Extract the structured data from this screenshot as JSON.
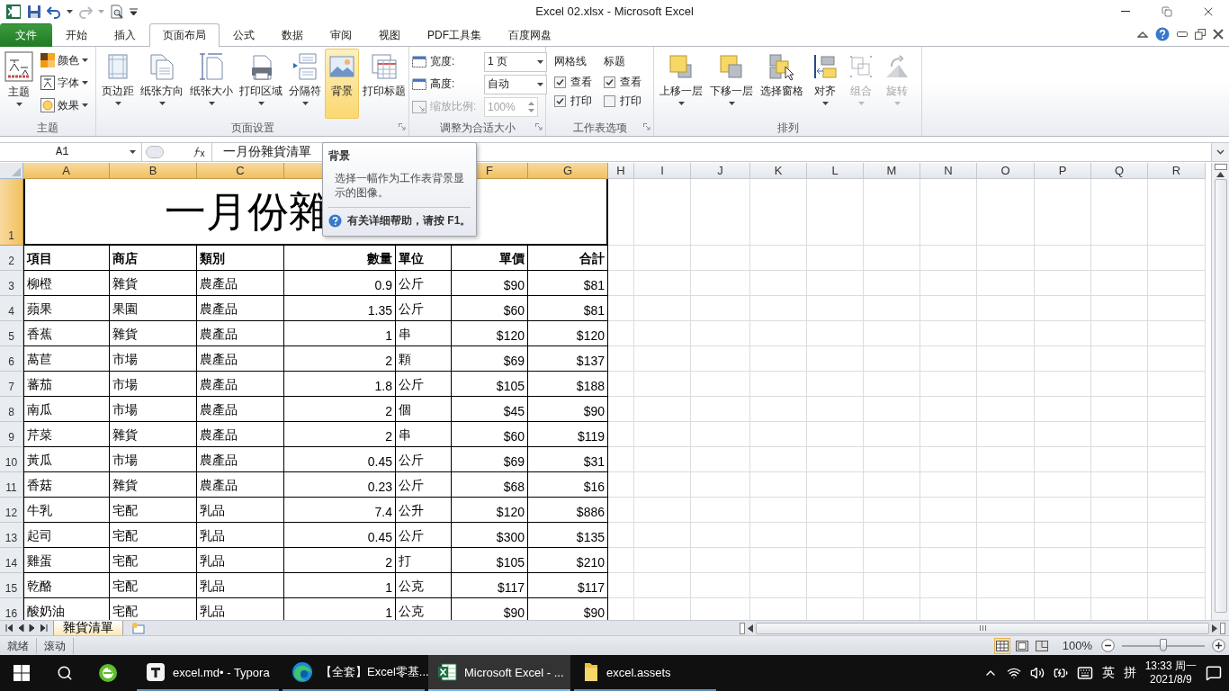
{
  "window": {
    "title": "Excel 02.xlsx  -  Microsoft Excel"
  },
  "ribbon_tabs": [
    {
      "label": "文件",
      "kind": "file",
      "selected": false
    },
    {
      "label": "开始",
      "kind": "tab",
      "selected": false
    },
    {
      "label": "插入",
      "kind": "tab",
      "selected": false
    },
    {
      "label": "页面布局",
      "kind": "tab",
      "selected": true
    },
    {
      "label": "公式",
      "kind": "tab",
      "selected": false
    },
    {
      "label": "数据",
      "kind": "tab",
      "selected": false
    },
    {
      "label": "审阅",
      "kind": "tab",
      "selected": false
    },
    {
      "label": "视图",
      "kind": "tab",
      "selected": false
    },
    {
      "label": "PDF工具集",
      "kind": "tab",
      "selected": false
    },
    {
      "label": "百度网盘",
      "kind": "tab",
      "selected": false
    }
  ],
  "theme_group": {
    "label": "主题",
    "button": "主题",
    "items": [
      {
        "label": "颜色",
        "kind": "colors"
      },
      {
        "label": "字体",
        "kind": "fonts"
      },
      {
        "label": "效果",
        "kind": "effects"
      }
    ]
  },
  "page_setup_group": {
    "label": "页面设置",
    "buttons": [
      {
        "label": "页边距",
        "kind": "margins",
        "dropdown": true,
        "selected": false
      },
      {
        "label": "纸张方向",
        "kind": "orientation",
        "dropdown": true,
        "selected": false
      },
      {
        "label": "纸张大小",
        "kind": "size",
        "dropdown": true,
        "selected": false
      },
      {
        "label": "打印区域",
        "kind": "print-area",
        "dropdown": true,
        "selected": false
      },
      {
        "label": "分隔符",
        "kind": "breaks",
        "dropdown": true,
        "selected": false
      },
      {
        "label": "背景",
        "kind": "background",
        "dropdown": false,
        "selected": true
      },
      {
        "label": "打印标题",
        "kind": "print-titles",
        "dropdown": false,
        "selected": false
      }
    ]
  },
  "scale_group": {
    "label": "调整为合适大小",
    "width": {
      "label": "宽度:",
      "value": "1 页"
    },
    "height": {
      "label": "高度:",
      "value": "自动"
    },
    "scale": {
      "label": "缩放比例:",
      "value": "100%",
      "disabled": true
    }
  },
  "sheet_options_group": {
    "label": "工作表选项",
    "columns": [
      {
        "title": "网格线",
        "view": {
          "label": "查看",
          "checked": true
        },
        "print": {
          "label": "打印",
          "checked": true
        }
      },
      {
        "title": "标题",
        "view": {
          "label": "查看",
          "checked": true
        },
        "print": {
          "label": "打印",
          "checked": false
        }
      }
    ]
  },
  "arrange_group": {
    "label": "排列",
    "buttons": [
      {
        "label": "上移一层",
        "kind": "bring-forward",
        "dropdown": true,
        "disabled": false
      },
      {
        "label": "下移一层",
        "kind": "send-backward",
        "dropdown": true,
        "disabled": false
      },
      {
        "label": "选择窗格",
        "kind": "selection-pane",
        "dropdown": false,
        "disabled": false
      },
      {
        "label": "对齐",
        "kind": "align",
        "dropdown": true,
        "disabled": false
      },
      {
        "label": "组合",
        "kind": "group",
        "dropdown": true,
        "disabled": true
      },
      {
        "label": "旋转",
        "kind": "rotate",
        "dropdown": true,
        "disabled": true
      }
    ]
  },
  "formula_bar": {
    "name_box": "A1",
    "formula": "一月份雜貨清單"
  },
  "tooltip": {
    "title": "背景",
    "body": "选择一幅作为工作表背景显示的图像。",
    "help": "有关详细帮助，请按 F1。"
  },
  "sheet": {
    "columns": [
      {
        "label": "A",
        "selected": true
      },
      {
        "label": "B",
        "selected": true
      },
      {
        "label": "C",
        "selected": true
      },
      {
        "selected": true
      },
      {},
      {
        "label": "F",
        "selected": true
      },
      {
        "label": "G",
        "selected": true
      },
      {
        "label": "H",
        "selected": false
      },
      {
        "label": "I",
        "selected": false
      },
      {
        "label": "J",
        "selected": false
      },
      {
        "label": "K",
        "selected": false
      },
      {
        "label": "L",
        "selected": false
      },
      {
        "label": "M",
        "selected": false
      },
      {
        "label": "N",
        "selected": false
      },
      {
        "label": "O",
        "selected": false
      },
      {
        "label": "P",
        "selected": false
      },
      {
        "label": "Q",
        "selected": false
      },
      {
        "label": "R",
        "selected": false
      }
    ],
    "rows": [
      {
        "number": "1",
        "selected": true,
        "kind": "title",
        "cells": [
          "",
          "",
          "一月份雜"
        ]
      },
      {
        "number": "2",
        "selected": false,
        "kind": "header",
        "cells": [
          "項目",
          "商店",
          "類別",
          "數量",
          "單位",
          "單價",
          "合計"
        ]
      },
      {
        "number": "3",
        "selected": false,
        "kind": "data",
        "cells": [
          "柳橙",
          "雜貨",
          "農產品",
          "0.9",
          "公斤",
          "$90",
          "$81"
        ]
      },
      {
        "number": "4",
        "selected": false,
        "kind": "data",
        "cells": [
          "蘋果",
          "果園",
          "農產品",
          "1.35",
          "公斤",
          "$60",
          "$81"
        ]
      },
      {
        "number": "5",
        "selected": false,
        "kind": "data",
        "cells": [
          "香蕉",
          "雜貨",
          "農產品",
          "1",
          "串",
          "$120",
          "$120"
        ]
      },
      {
        "number": "6",
        "selected": false,
        "kind": "data",
        "cells": [
          "萵苣",
          "市場",
          "農產品",
          "2",
          "顆",
          "$69",
          "$137"
        ]
      },
      {
        "number": "7",
        "selected": false,
        "kind": "data",
        "cells": [
          "蕃茄",
          "市場",
          "農產品",
          "1.8",
          "公斤",
          "$105",
          "$188"
        ]
      },
      {
        "number": "8",
        "selected": false,
        "kind": "data",
        "cells": [
          "南瓜",
          "市場",
          "農產品",
          "2",
          "個",
          "$45",
          "$90"
        ]
      },
      {
        "number": "9",
        "selected": false,
        "kind": "data",
        "cells": [
          "芹菜",
          "雜貨",
          "農產品",
          "2",
          "串",
          "$60",
          "$119"
        ]
      },
      {
        "number": "10",
        "selected": false,
        "kind": "data",
        "cells": [
          "黃瓜",
          "市場",
          "農產品",
          "0.45",
          "公斤",
          "$69",
          "$31"
        ]
      },
      {
        "number": "11",
        "selected": false,
        "kind": "data",
        "cells": [
          "香菇",
          "雜貨",
          "農產品",
          "0.23",
          "公斤",
          "$68",
          "$16"
        ]
      },
      {
        "number": "12",
        "selected": false,
        "kind": "data",
        "cells": [
          "牛乳",
          "宅配",
          "乳品",
          "7.4",
          "公升",
          "$120",
          "$886"
        ]
      },
      {
        "number": "13",
        "selected": false,
        "kind": "data",
        "cells": [
          "起司",
          "宅配",
          "乳品",
          "0.45",
          "公斤",
          "$300",
          "$135"
        ]
      },
      {
        "number": "14",
        "selected": false,
        "kind": "data",
        "cells": [
          "雞蛋",
          "宅配",
          "乳品",
          "2",
          "打",
          "$105",
          "$210"
        ]
      },
      {
        "number": "15",
        "selected": false,
        "kind": "data",
        "cells": [
          "乾酪",
          "宅配",
          "乳品",
          "1",
          "公克",
          "$117",
          "$117"
        ]
      },
      {
        "number": "16",
        "selected": false,
        "kind": "data",
        "cells": [
          "酸奶油",
          "宅配",
          "乳品",
          "1",
          "公克",
          "$90",
          "$90"
        ]
      }
    ]
  },
  "sheet_tabs": [
    {
      "label": "雜貨清單",
      "selected": true
    }
  ],
  "status_bar": {
    "items": [
      "就绪",
      "滚动"
    ],
    "views": [
      {
        "kind": "normal",
        "selected": true
      },
      {
        "kind": "page-layout",
        "selected": false
      },
      {
        "kind": "page-break",
        "selected": false
      }
    ],
    "zoom": "100%",
    "level": 0.5
  },
  "taskbar": {
    "apps": [
      {
        "label": "excel.md• - Typora",
        "kind": "typora",
        "selected": false
      },
      {
        "label": "【全套】Excel零基...",
        "kind": "edge",
        "selected": false
      },
      {
        "label": "Microsoft Excel - ...",
        "kind": "excel",
        "selected": true
      },
      {
        "label": "excel.assets",
        "kind": "folder",
        "selected": false
      }
    ],
    "tray": {
      "ime": "英",
      "ime_mode": "拼",
      "time": "13:33 周一",
      "date": "2021/8/9"
    }
  }
}
